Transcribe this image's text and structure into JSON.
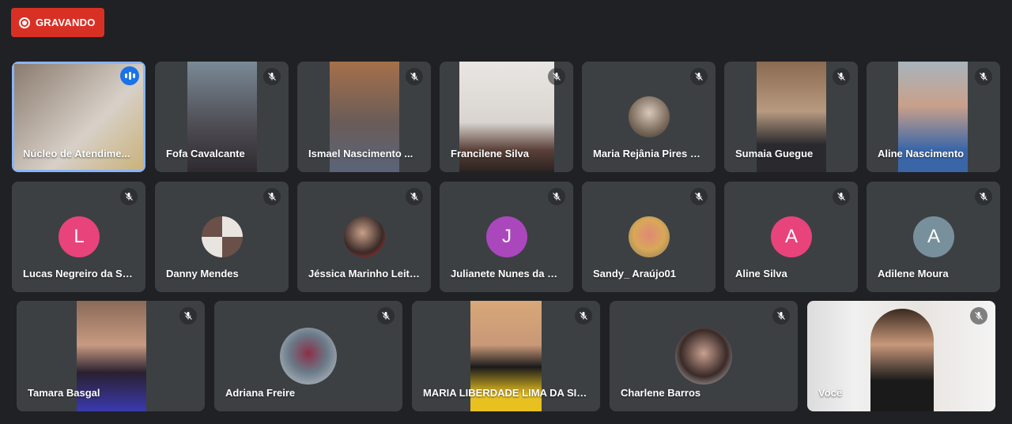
{
  "recording": {
    "label": "GRAVANDO"
  },
  "participants": [
    {
      "name": "Núcleo de Atendime..."
    },
    {
      "name": "Fofa Cavalcante"
    },
    {
      "name": "Ismael Nascimento ..."
    },
    {
      "name": "Francilene Silva"
    },
    {
      "name": "Maria Rejânia Pires Li..."
    },
    {
      "name": "Sumaia Guegue"
    },
    {
      "name": "Aline Nascimento"
    },
    {
      "name": "Lucas Negreiro da Silva",
      "initial": "L",
      "color": "#e8437a"
    },
    {
      "name": "Danny Mendes"
    },
    {
      "name": "Jéssica Marinho Leite..."
    },
    {
      "name": "Julianete Nunes da sil...",
      "initial": "J",
      "color": "#ab47bc"
    },
    {
      "name": "Sandy_ Araújo01"
    },
    {
      "name": "Aline Silva",
      "initial": "A",
      "color": "#e8437a"
    },
    {
      "name": "Adilene Moura",
      "initial": "A",
      "color": "#78909c"
    },
    {
      "name": "Tamara Basgal"
    },
    {
      "name": "Adriana Freire"
    },
    {
      "name": "MARIA LIBERDADE LIMA DA SIL..."
    },
    {
      "name": "Charlene Barros"
    },
    {
      "name": "Você"
    }
  ]
}
